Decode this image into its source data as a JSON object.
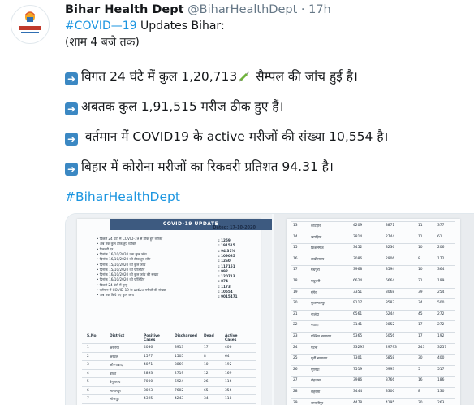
{
  "tweet": {
    "author_name": "Bihar Health Dept",
    "handle": "@BiharHealthDept",
    "separator": "·",
    "time": "17h",
    "hashtag_covid": "#COVID—19",
    "title_rest": " Updates Bihar:",
    "subtitle": "(शाम 4 बजे तक)",
    "line1_a": "विगत 24 घंटे में कुल 1,20,713",
    "line1_b": " सैम्पल की जांच हुई है।",
    "line2": "अबतक कुल 1,91,515 मरीज ठीक हुए हैं।",
    "line3": " वर्तमान में COVID19 के active मरीजों की संख्या 10,554 है।",
    "line4": "बिहार में कोरोना मरीजों का रिकवरी प्रतिशत 94.31 है।",
    "hashtag_footer": "#BiharHealthDept"
  },
  "icons": {
    "arrow": "right-arrow-icon",
    "syringe": "syringe-icon"
  },
  "colors": {
    "link": "#1b95e0",
    "arrow_bg": "#3b88c3",
    "doc_header": "#3d5a80"
  },
  "media": {
    "doc1": {
      "header": "COVID-19 UPDATE",
      "date": "Dated: 17-10-2020",
      "summary": [
        {
          "k": "पिछले 24 घंटों में COVID-19 से ठीक हुए व्यक्ति",
          "v": "1259"
        },
        {
          "k": "अब तक कुल ठीक हुए व्यक्ति",
          "v": "191515"
        },
        {
          "k": "रिकवरी दर",
          "v": "94.31%"
        },
        {
          "k": "दिनांक 16/10/2020 तक कुल जाँच",
          "v": "109085"
        },
        {
          "k": "दिनांक 16/10/2020 को ठीक हुए लोग",
          "v": "1260"
        },
        {
          "k": "दिनांक 15/10/2020 को कुल जांच",
          "v": "117151"
        },
        {
          "k": "दिनांक 15/10/2020 को पॉजिटिव",
          "v": "992"
        },
        {
          "k": "दिनांक 16/10/2020 को कुल जांच की संख्या",
          "v": "120713"
        },
        {
          "k": "दिनांक 16/10/2020 को पॉजिटिव",
          "v": "874"
        },
        {
          "k": "पिछले 24 घंटों में मृत्यु",
          "v": "1173"
        },
        {
          "k": "वर्तमान में COVID-19 के active मरीजों की संख्या",
          "v": "10554"
        },
        {
          "k": "अब तक किये गए कुल जांच",
          "v": "9015471"
        }
      ],
      "columns": [
        "S.No.",
        "District",
        "Positive Cases",
        "Discharged",
        "Dead",
        "Active Cases"
      ],
      "rows": [
        [
          "1",
          "अररिया",
          "4036",
          "3913",
          "17",
          "406"
        ],
        [
          "2",
          "अरवल",
          "1577",
          "1505",
          "8",
          "64"
        ],
        [
          "3",
          "औरंगाबाद",
          "4071",
          "3869",
          "10",
          "192"
        ],
        [
          "4",
          "बांका",
          "2893",
          "2719",
          "12",
          "169"
        ],
        [
          "5",
          "बेगूसराय",
          "7000",
          "6924",
          "26",
          "116"
        ],
        [
          "6",
          "भागलपुर",
          "8023",
          "7602",
          "65",
          "356"
        ],
        [
          "7",
          "भोजपुर",
          "4395",
          "4243",
          "34",
          "118"
        ],
        [
          "8",
          "बक्सर",
          "3618",
          "3564",
          "13",
          "33"
        ]
      ]
    },
    "doc2": {
      "rows": [
        [
          "13",
          "कटिहार",
          "4209",
          "3871",
          "11",
          "377"
        ],
        [
          "14",
          "खगड़िया",
          "2814",
          "2744",
          "11",
          "61"
        ],
        [
          "15",
          "किशनगंज",
          "3452",
          "3236",
          "10",
          "206"
        ],
        [
          "16",
          "लखीसराय",
          "3086",
          "2906",
          "8",
          "172"
        ],
        [
          "17",
          "मधेपुरा",
          "3968",
          "3594",
          "10",
          "364"
        ],
        [
          "18",
          "मधुबनी",
          "6624",
          "6664",
          "21",
          "199"
        ],
        [
          "19",
          "मुंगेर",
          "3351",
          "3068",
          "39",
          "254"
        ],
        [
          "20",
          "मुजफ्फरपुर",
          "9117",
          "8583",
          "34",
          "500"
        ],
        [
          "21",
          "नालंदा",
          "6561",
          "6244",
          "45",
          "272"
        ],
        [
          "22",
          "नवादा",
          "3141",
          "2852",
          "17",
          "272"
        ],
        [
          "23",
          "पश्चिम चम्पारण",
          "5365",
          "5056",
          "17",
          "192"
        ],
        [
          "24",
          "पटना",
          "33293",
          "29793",
          "243",
          "3257"
        ],
        [
          "25",
          "पूर्वी चम्पारण",
          "7301",
          "6858",
          "30",
          "400"
        ],
        [
          "26",
          "पूर्णिया",
          "7519",
          "6993",
          "5",
          "517"
        ],
        [
          "27",
          "रोहतास",
          "3986",
          "3766",
          "16",
          "186"
        ],
        [
          "28",
          "सहरसा",
          "3444",
          "3300",
          "8",
          "130"
        ],
        [
          "29",
          "समस्तीपुर",
          "4478",
          "4195",
          "20",
          "263"
        ]
      ]
    }
  }
}
